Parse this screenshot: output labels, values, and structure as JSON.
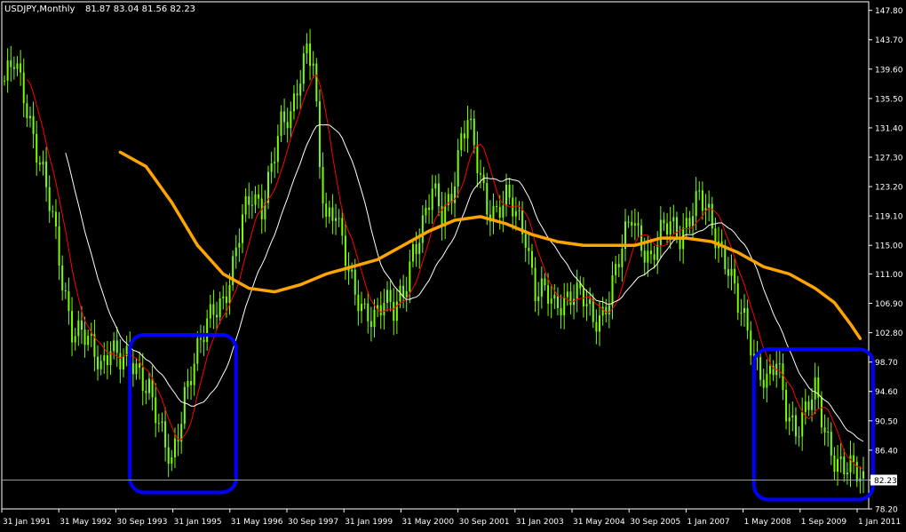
{
  "header": {
    "symbol": "USDJPY,Monthly",
    "ohlc": "81.87 83.04 81.56 82.23"
  },
  "colors": {
    "background": "#000000",
    "candles": "#7CFC00",
    "ma_fast": "#ff0000",
    "ma_mid": "#ffffff",
    "ma_slow": "#ffa500",
    "highlight_box": "#0000ff",
    "price_line": "#9a9a9a",
    "frame": "#ffffff"
  },
  "chart_data": {
    "type": "candlestick",
    "y_ticks": [
      "147.80",
      "143.70",
      "139.60",
      "135.50",
      "131.40",
      "127.30",
      "123.20",
      "119.10",
      "115.00",
      "111.00",
      "106.90",
      "102.80",
      "98.70",
      "94.60",
      "90.50",
      "86.40",
      "82.23",
      "78.20"
    ],
    "ylim": [
      78.2,
      149.0
    ],
    "current_price": 82.23,
    "current_price_label": "82.23",
    "x_ticks": [
      "31 Jan 1991",
      "31 May 1992",
      "30 Sep 1993",
      "31 Jan 1995",
      "31 May 1996",
      "30 Sep 1997",
      "31 Jan 1999",
      "31 May 2000",
      "30 Sep 2001",
      "31 Jan 2003",
      "31 May 2004",
      "30 Sep 2005",
      "1 Jan 2007",
      "1 May 2008",
      "1 Sep 2009",
      "1 Jan 2011"
    ],
    "price_path": [
      [
        0,
        138
      ],
      [
        3,
        140
      ],
      [
        6,
        136
      ],
      [
        9,
        131
      ],
      [
        12,
        125
      ],
      [
        15,
        118
      ],
      [
        18,
        110
      ],
      [
        21,
        104
      ],
      [
        24,
        103
      ],
      [
        27,
        100
      ],
      [
        30,
        98
      ],
      [
        33,
        102
      ],
      [
        36,
        99
      ],
      [
        39,
        98
      ],
      [
        42,
        97
      ],
      [
        45,
        96
      ],
      [
        48,
        90
      ],
      [
        50,
        86
      ],
      [
        52,
        84
      ],
      [
        54,
        89
      ],
      [
        56,
        95
      ],
      [
        59,
        99
      ],
      [
        62,
        102
      ],
      [
        65,
        106
      ],
      [
        68,
        108
      ],
      [
        71,
        112
      ],
      [
        74,
        118
      ],
      [
        77,
        122
      ],
      [
        80,
        121
      ],
      [
        83,
        126
      ],
      [
        86,
        131
      ],
      [
        89,
        133
      ],
      [
        91,
        138
      ],
      [
        94,
        143
      ],
      [
        96,
        140
      ],
      [
        98,
        125
      ],
      [
        100,
        118
      ],
      [
        103,
        121
      ],
      [
        106,
        114
      ],
      [
        109,
        107
      ],
      [
        112,
        105
      ],
      [
        115,
        106
      ],
      [
        118,
        108
      ],
      [
        121,
        105
      ],
      [
        124,
        108
      ],
      [
        127,
        115
      ],
      [
        130,
        118
      ],
      [
        133,
        122
      ],
      [
        136,
        119
      ],
      [
        139,
        123
      ],
      [
        142,
        130
      ],
      [
        144,
        132
      ],
      [
        147,
        126
      ],
      [
        150,
        121
      ],
      [
        153,
        120
      ],
      [
        156,
        121
      ],
      [
        159,
        119
      ],
      [
        162,
        117
      ],
      [
        165,
        109
      ],
      [
        168,
        108
      ],
      [
        171,
        106
      ],
      [
        174,
        108
      ],
      [
        177,
        109
      ],
      [
        180,
        107
      ],
      [
        183,
        104
      ],
      [
        186,
        106
      ],
      [
        189,
        110
      ],
      [
        192,
        114
      ],
      [
        195,
        119
      ],
      [
        198,
        116
      ],
      [
        201,
        113
      ],
      [
        204,
        116
      ],
      [
        207,
        118
      ],
      [
        210,
        117
      ],
      [
        213,
        119
      ],
      [
        216,
        121
      ],
      [
        219,
        119
      ],
      [
        222,
        116
      ],
      [
        225,
        112
      ],
      [
        228,
        106
      ],
      [
        231,
        103
      ],
      [
        234,
        99
      ],
      [
        237,
        96
      ],
      [
        240,
        98
      ],
      [
        243,
        92
      ],
      [
        246,
        90
      ],
      [
        249,
        92
      ],
      [
        252,
        94
      ],
      [
        255,
        89
      ],
      [
        258,
        86
      ],
      [
        261,
        84
      ],
      [
        264,
        83
      ],
      [
        267,
        82
      ]
    ],
    "series": [
      {
        "name": "",
        "role": "moving-average-fast",
        "color": "#ff0000"
      },
      {
        "name": "",
        "role": "moving-average-mid",
        "color": "#ffffff"
      },
      {
        "name": "",
        "role": "moving-average-slow",
        "color": "#ffa500"
      }
    ],
    "slow_ma_points": [
      [
        36,
        128
      ],
      [
        44,
        126
      ],
      [
        52,
        121
      ],
      [
        60,
        115
      ],
      [
        68,
        111
      ],
      [
        76,
        109
      ],
      [
        84,
        108.5
      ],
      [
        92,
        109.5
      ],
      [
        100,
        111
      ],
      [
        108,
        112
      ],
      [
        116,
        113
      ],
      [
        124,
        115
      ],
      [
        132,
        117
      ],
      [
        140,
        118.5
      ],
      [
        148,
        119
      ],
      [
        156,
        118
      ],
      [
        164,
        116.5
      ],
      [
        172,
        115.5
      ],
      [
        180,
        115
      ],
      [
        188,
        115
      ],
      [
        196,
        115
      ],
      [
        204,
        116
      ],
      [
        212,
        116
      ],
      [
        220,
        115.5
      ],
      [
        228,
        114
      ],
      [
        236,
        112
      ],
      [
        244,
        111
      ],
      [
        252,
        109
      ],
      [
        258,
        107
      ],
      [
        263,
        104
      ],
      [
        266,
        102
      ]
    ],
    "highlight_boxes": [
      {
        "x_range": [
          39,
          72
        ],
        "y_range": [
          80.5,
          102.5
        ],
        "label": ""
      },
      {
        "x_range": [
          233,
          270
        ],
        "y_range": [
          79.5,
          100.5
        ],
        "label": ""
      }
    ],
    "grid": false,
    "legend": "none"
  }
}
